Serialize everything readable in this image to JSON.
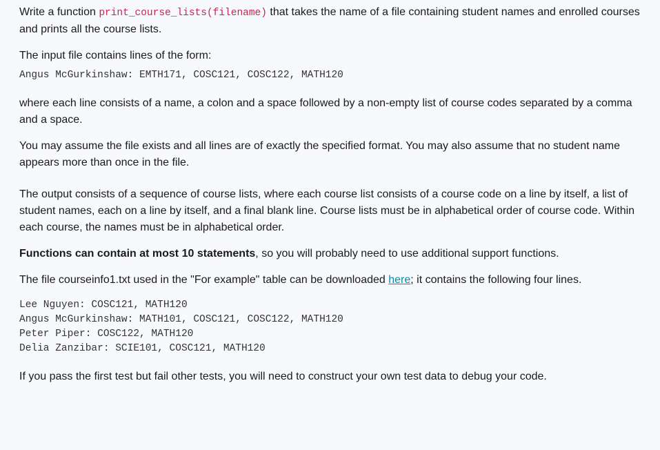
{
  "para1_a": "Write a function ",
  "para1_code": "print_course_lists(filename)",
  "para1_b": " that takes the name of a file containing student names and enrolled courses and prints all the course lists.",
  "para2": "The input file contains lines of the form:",
  "example_line": "Angus McGurkinshaw: EMTH171, COSC121, COSC122, MATH120",
  "para3": "where each line consists of a name, a colon and a space followed by a non-empty list of course codes separated by a comma and a space.",
  "para4": "You may assume the file exists and all lines are of exactly the specified format. You may also assume that no student name appears more than once in the file.",
  "para5": "The output consists of a sequence of course lists, where each course list consists of a course code on a line by itself, a list of student names, each on a line by itself, and a final blank line. Course lists must be in alphabetical order of course code. Within each course, the names must be in alphabetical order.",
  "para6_strong": "Functions can contain at most 10 statements",
  "para6_rest": ", so you will probably need to use additional support functions.",
  "para7_a": "The file courseinfo1.txt used in the \"For example\" table can be downloaded ",
  "para7_link": "here",
  "para7_b": "; it contains the following four lines.",
  "file_contents": "Lee Nguyen: COSC121, MATH120\nAngus McGurkinshaw: MATH101, COSC121, COSC122, MATH120\nPeter Piper: COSC122, MATH120\nDelia Zanzibar: SCIE101, COSC121, MATH120",
  "para8": "If you pass the first test but fail other tests, you will need to construct your own test data to debug your code."
}
